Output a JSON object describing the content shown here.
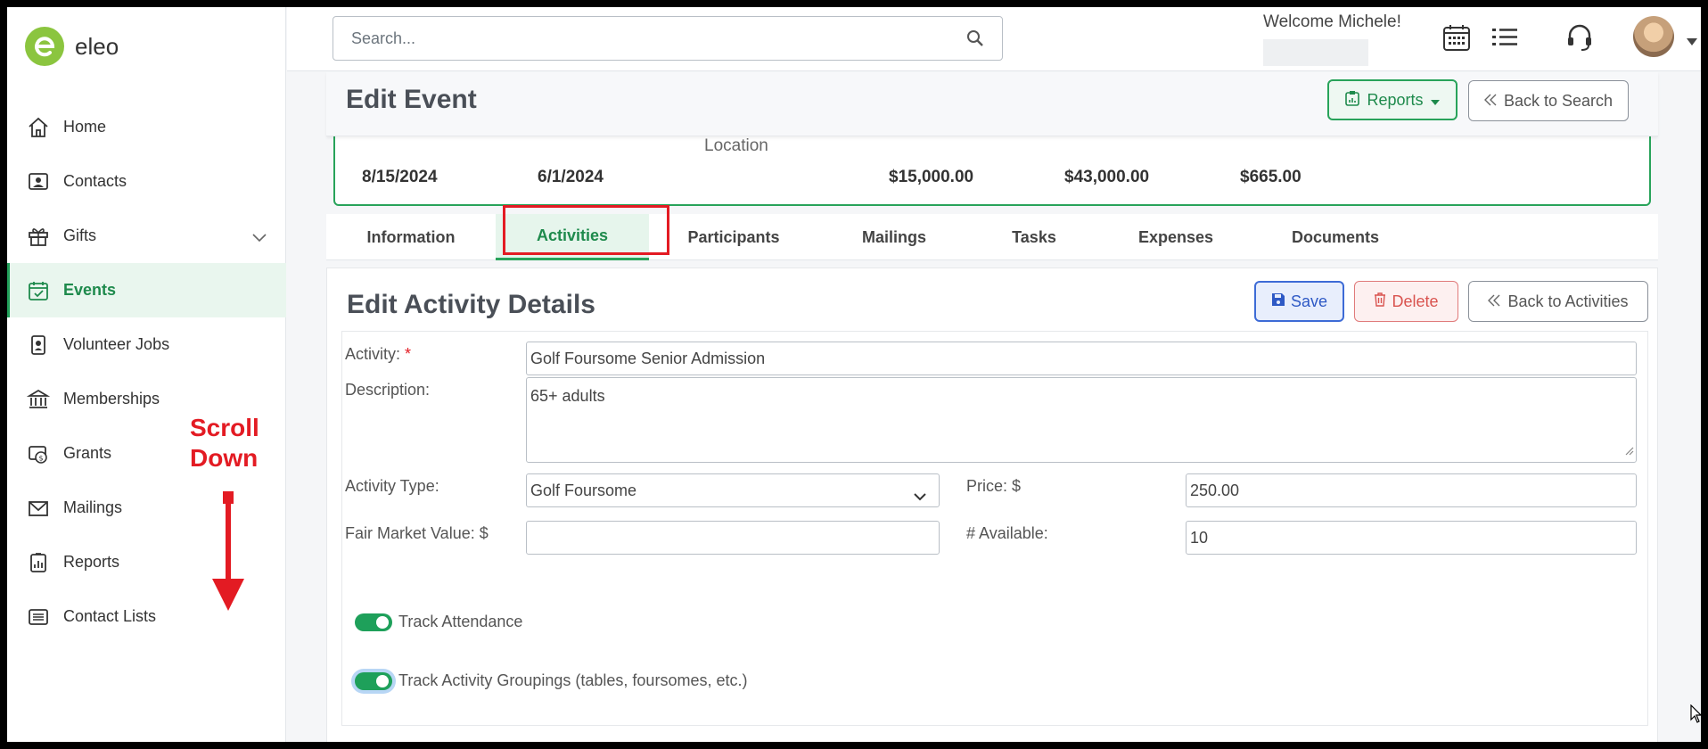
{
  "app": {
    "logo_text": "eleo"
  },
  "sidebar": {
    "items": [
      {
        "label": "Home",
        "icon": "home-icon"
      },
      {
        "label": "Contacts",
        "icon": "contacts-icon"
      },
      {
        "label": "Gifts",
        "icon": "gift-icon"
      },
      {
        "label": "Events",
        "icon": "calendar-check-icon"
      },
      {
        "label": "Volunteer Jobs",
        "icon": "badge-icon"
      },
      {
        "label": "Memberships",
        "icon": "building-icon"
      },
      {
        "label": "Grants",
        "icon": "grants-icon"
      },
      {
        "label": "Mailings",
        "icon": "envelope-icon"
      },
      {
        "label": "Reports",
        "icon": "report-icon"
      },
      {
        "label": "Contact Lists",
        "icon": "list-icon"
      }
    ],
    "active": "Events"
  },
  "annotation": {
    "line1": "Scroll",
    "line2": "Down",
    "color": "#e31b23"
  },
  "topbar": {
    "search_placeholder": "Search...",
    "welcome": "Welcome Michele!"
  },
  "header": {
    "title": "Edit Event",
    "reports_label": "Reports",
    "back_label": "Back to Search"
  },
  "summary": {
    "partial_label": "Location",
    "values": [
      "8/15/2024",
      "6/1/2024",
      "$15,000.00",
      "$43,000.00",
      "$665.00"
    ]
  },
  "tabs": [
    {
      "label": "Information"
    },
    {
      "label": "Activities"
    },
    {
      "label": "Participants"
    },
    {
      "label": "Mailings"
    },
    {
      "label": "Tasks"
    },
    {
      "label": "Expenses"
    },
    {
      "label": "Documents"
    }
  ],
  "active_tab": "Activities",
  "panel": {
    "title": "Edit Activity Details",
    "save_label": "Save",
    "delete_label": "Delete",
    "back_label": "Back to Activities"
  },
  "form": {
    "activity_label": "Activity:",
    "activity_required": "*",
    "activity_value": "Golf Foursome Senior Admission",
    "description_label": "Description:",
    "description_value": "65+ adults",
    "type_label": "Activity Type:",
    "type_value": "Golf Foursome",
    "price_label": "Price: $",
    "price_value": "250.00",
    "fmv_label": "Fair Market Value: $",
    "fmv_value": "",
    "available_label": "# Available:",
    "available_value": "10",
    "track_attendance_label": "Track Attendance",
    "track_attendance": true,
    "track_groupings_label": "Track Activity Groupings (tables, foursomes, etc.)",
    "track_groupings": true
  },
  "colors": {
    "accent": "#28a35a",
    "save": "#3d6bd6",
    "delete": "#d9534f"
  }
}
